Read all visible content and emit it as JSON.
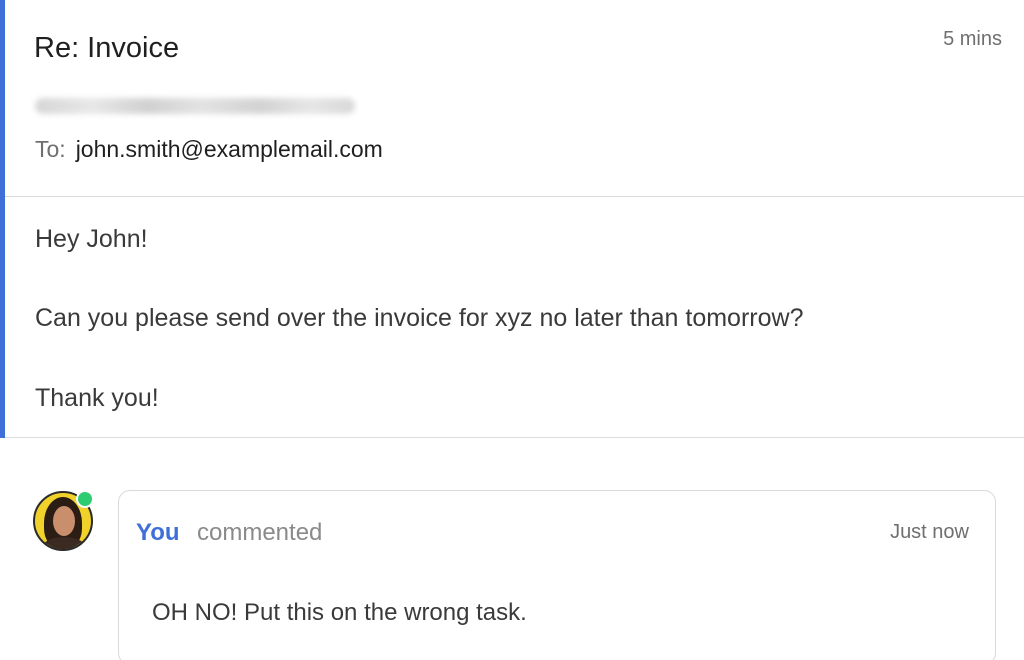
{
  "email": {
    "subject": "Re: Invoice",
    "timestamp": "5 mins",
    "to_label": "To:",
    "to_address": "john.smith@examplemail.com",
    "body": {
      "greeting": "Hey John!",
      "request": "Can you please send over the invoice for xyz no later than tomorrow?",
      "thanks": "Thank you!"
    }
  },
  "comment": {
    "author": "You",
    "action": "commented",
    "time": "Just now",
    "text": "OH NO! Put this on the wrong task.",
    "online": true
  },
  "colors": {
    "accent": "#3f6fd8",
    "online_status": "#2ecc71",
    "avatar_background": "#f1d22a"
  }
}
